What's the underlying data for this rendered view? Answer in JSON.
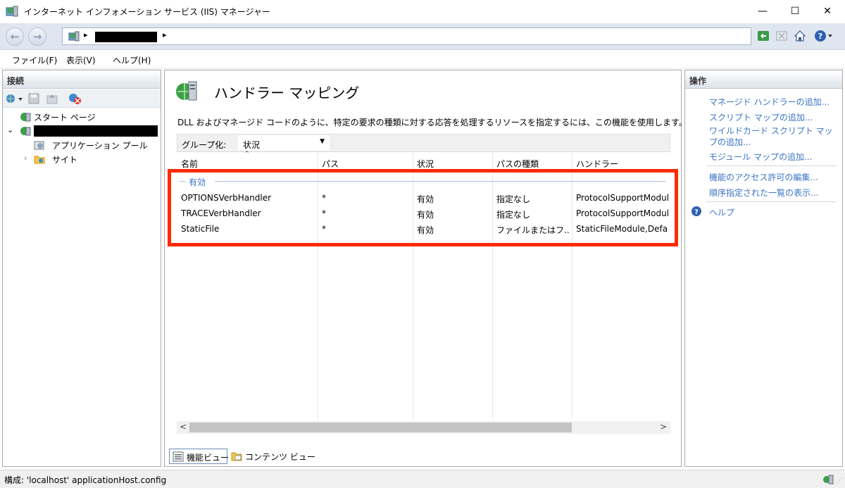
{
  "window": {
    "title": "インターネット インフォメーション サービス (IIS) マネージャー",
    "controls": {
      "minimize": "—",
      "maximize": "☐",
      "close": "✕"
    }
  },
  "address": {
    "separator": "▸"
  },
  "menu": {
    "items": [
      {
        "label": "ファイル(F)"
      },
      {
        "label": "表示(V)"
      },
      {
        "label": "ヘルプ(H)"
      }
    ]
  },
  "connections": {
    "header": "接続",
    "tree": [
      {
        "label": "スタート ページ",
        "icon": "start-page-icon"
      },
      {
        "label": "",
        "icon": "server-icon",
        "redacted": true
      },
      {
        "label": "アプリケーション プール",
        "icon": "app-pool-icon"
      },
      {
        "label": "サイト",
        "icon": "sites-folder-icon"
      }
    ]
  },
  "feature": {
    "title": "ハンドラー マッピング",
    "description": "DLL およびマネージド コードのように、特定の要求の種類に対する応答を処理するリソースを指定するには、この機能を使用します。",
    "group_by_label": "グループ化:",
    "group_by_value": "状況",
    "columns": [
      "名前",
      "パス",
      "状況",
      "パスの種類",
      "ハンドラー"
    ],
    "group_header": "有効",
    "rows": [
      {
        "name": "OPTIONSVerbHandler",
        "path": "*",
        "state": "有効",
        "path_type": "指定なし",
        "handler": "ProtocolSupportModule"
      },
      {
        "name": "TRACEVerbHandler",
        "path": "*",
        "state": "有効",
        "path_type": "指定なし",
        "handler": "ProtocolSupportModule"
      },
      {
        "name": "StaticFile",
        "path": "*",
        "state": "有効",
        "path_type": "ファイルまたはフ...",
        "handler": "StaticFileModule,DefaultDocumentModule"
      }
    ],
    "scroll_left": "<",
    "scroll_right": ">"
  },
  "views": {
    "features": "機能ビュー",
    "content": "コンテンツ ビュー"
  },
  "actions": {
    "header": "操作",
    "links": [
      "マネージド ハンドラーの追加...",
      "スクリプト マップの追加...",
      "ワイルドカード スクリプト マップの追加...",
      "モジュール マップの追加...",
      "機能のアクセス許可の編集...",
      "順序指定された一覧の表示...",
      "ヘルプ"
    ]
  },
  "status": {
    "text": "構成: 'localhost' applicationHost.config"
  },
  "colors": {
    "accent_link": "#3a73c4",
    "highlight_border": "#ff2a00"
  }
}
